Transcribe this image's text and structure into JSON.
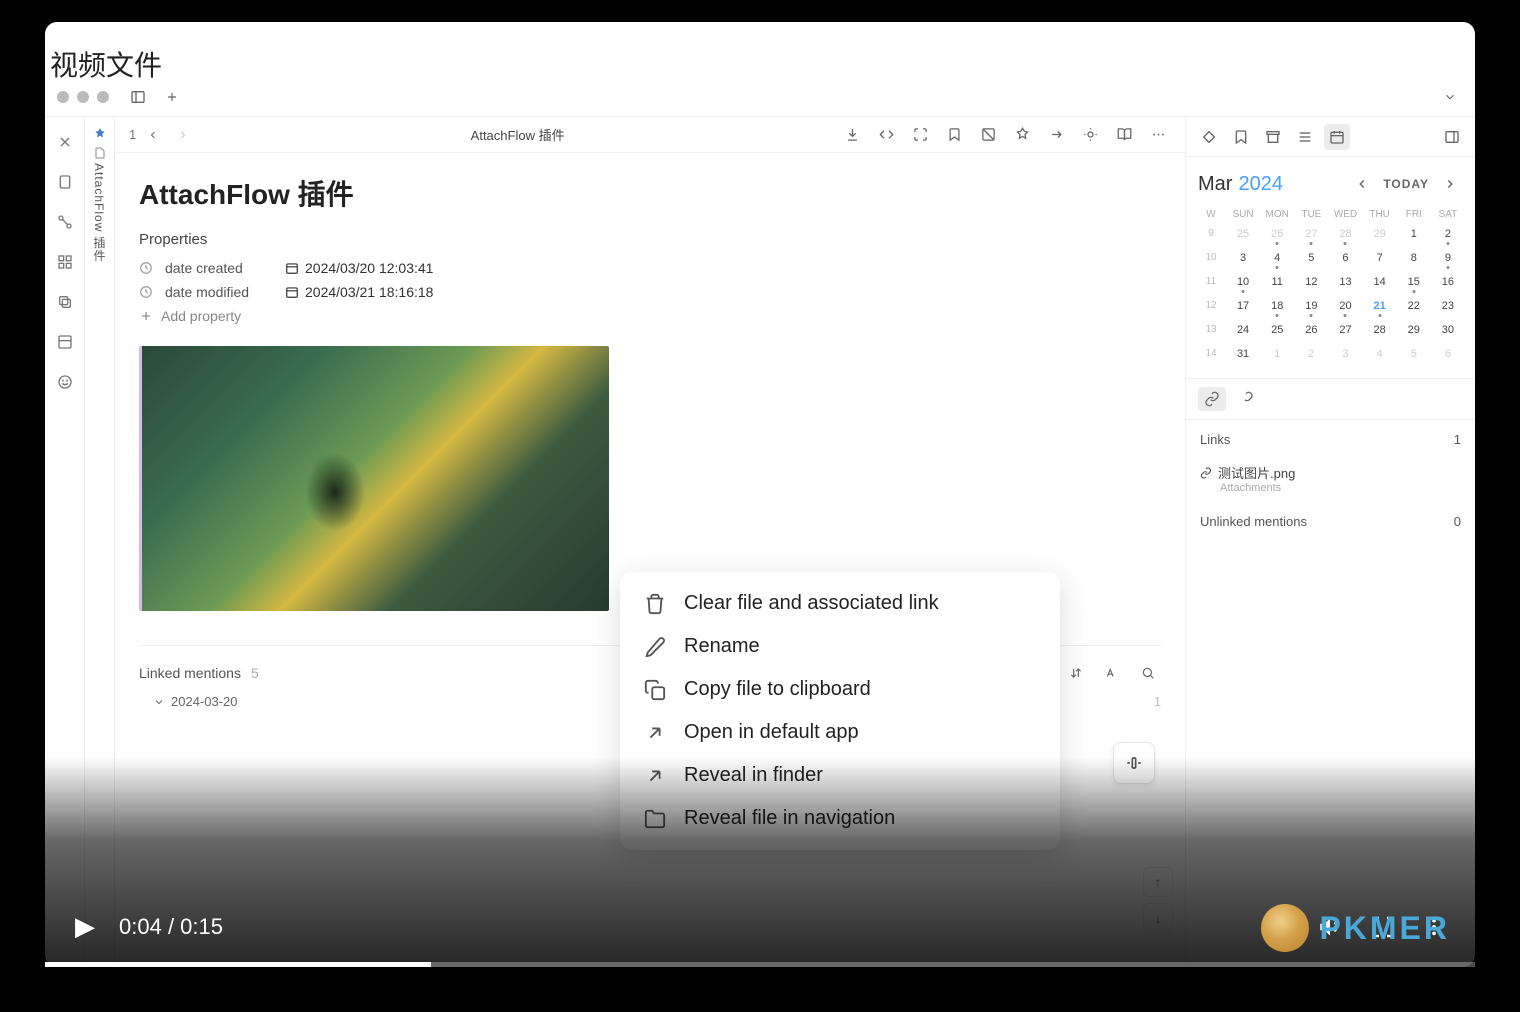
{
  "pageTitle": "视频文件",
  "tab": {
    "title": "AttachFlow 插件"
  },
  "breadcrumb": {
    "index": "1"
  },
  "note": {
    "title": "AttachFlow 插件",
    "propertiesLabel": "Properties",
    "props": {
      "created": {
        "label": "date created",
        "value": "2024/03/20 12:03:41"
      },
      "modified": {
        "label": "date modified",
        "value": "2024/03/21 18:16:18"
      }
    },
    "addProperty": "Add property"
  },
  "contextMenu": {
    "items": [
      {
        "icon": "trash",
        "label": "Clear file and associated link"
      },
      {
        "icon": "pencil",
        "label": "Rename"
      },
      {
        "icon": "copy",
        "label": "Copy file to clipboard"
      },
      {
        "icon": "external",
        "label": "Open in default app"
      },
      {
        "icon": "external",
        "label": "Reveal in finder"
      },
      {
        "icon": "folder",
        "label": "Reveal file in navigation"
      }
    ]
  },
  "linked": {
    "title": "Linked mentions",
    "count": "5",
    "dateGroup": "2024-03-20",
    "dateCount": "1"
  },
  "calendar": {
    "month": "Mar",
    "year": "2024",
    "today": "TODAY",
    "wdays": [
      "W",
      "SUN",
      "MON",
      "TUE",
      "WED",
      "THU",
      "FRI",
      "SAT"
    ],
    "weeks": [
      {
        "num": "9",
        "days": [
          {
            "d": "25",
            "o": true
          },
          {
            "d": "26",
            "o": true,
            "dot": true
          },
          {
            "d": "27",
            "o": true,
            "dot": true
          },
          {
            "d": "28",
            "o": true,
            "dot": true
          },
          {
            "d": "29",
            "o": true
          },
          {
            "d": "1"
          },
          {
            "d": "2",
            "dot": true
          }
        ]
      },
      {
        "num": "10",
        "days": [
          {
            "d": "3"
          },
          {
            "d": "4",
            "dot": true
          },
          {
            "d": "5"
          },
          {
            "d": "6"
          },
          {
            "d": "7"
          },
          {
            "d": "8"
          },
          {
            "d": "9",
            "dot": true
          }
        ]
      },
      {
        "num": "11",
        "days": [
          {
            "d": "10",
            "dot": true
          },
          {
            "d": "11"
          },
          {
            "d": "12"
          },
          {
            "d": "13"
          },
          {
            "d": "14"
          },
          {
            "d": "15",
            "dot": true
          },
          {
            "d": "16"
          }
        ]
      },
      {
        "num": "12",
        "days": [
          {
            "d": "17"
          },
          {
            "d": "18",
            "dot": true
          },
          {
            "d": "19",
            "dot": true
          },
          {
            "d": "20",
            "dot": true
          },
          {
            "d": "21",
            "today": true,
            "dot": true
          },
          {
            "d": "22"
          },
          {
            "d": "23"
          }
        ]
      },
      {
        "num": "13",
        "days": [
          {
            "d": "24"
          },
          {
            "d": "25"
          },
          {
            "d": "26"
          },
          {
            "d": "27"
          },
          {
            "d": "28"
          },
          {
            "d": "29"
          },
          {
            "d": "30"
          }
        ]
      },
      {
        "num": "14",
        "days": [
          {
            "d": "31"
          },
          {
            "d": "1",
            "o": true
          },
          {
            "d": "2",
            "o": true
          },
          {
            "d": "3",
            "o": true
          },
          {
            "d": "4",
            "o": true
          },
          {
            "d": "5",
            "o": true
          },
          {
            "d": "6",
            "o": true
          }
        ]
      }
    ]
  },
  "links": {
    "header": "Links",
    "count": "1",
    "item": {
      "name": "测试图片.png",
      "sub": "Attachments"
    },
    "unlinked": "Unlinked mentions",
    "unlinkedCount": "0"
  },
  "video": {
    "current": "0:04",
    "total": "0:15",
    "separator": " / "
  },
  "watermark": "PKMER"
}
